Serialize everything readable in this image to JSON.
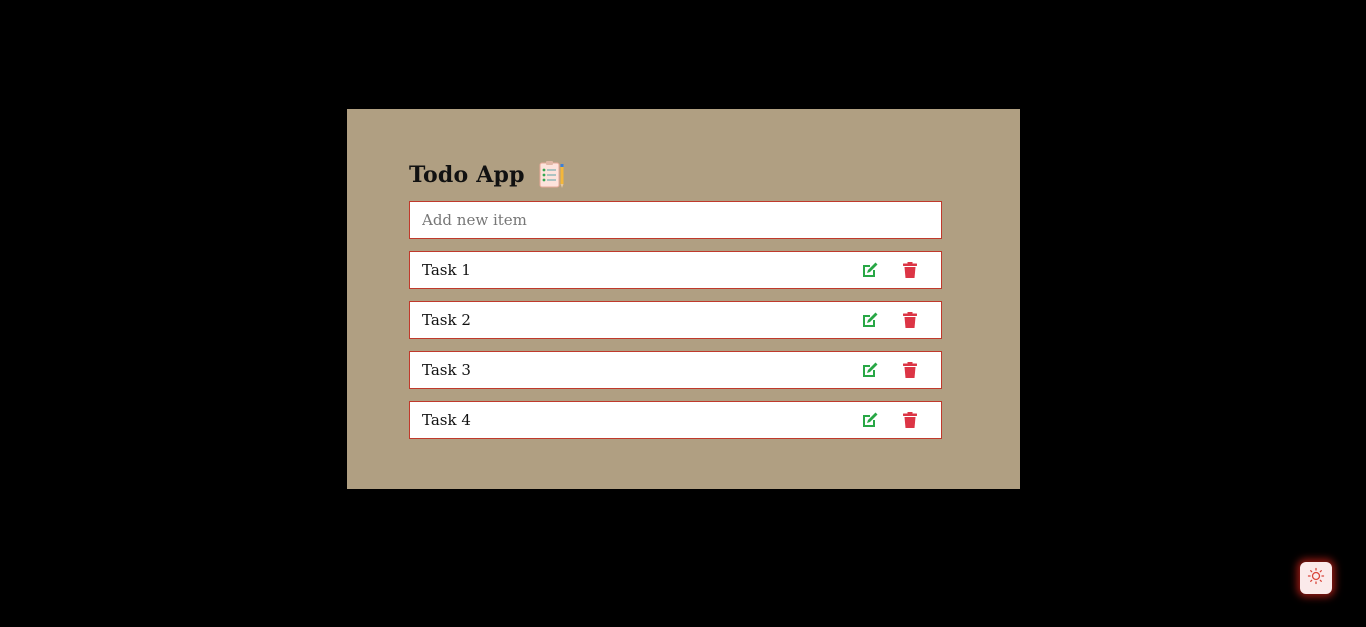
{
  "app": {
    "title": "Todo App"
  },
  "new_item": {
    "placeholder": "Add new item",
    "value": ""
  },
  "tasks": [
    {
      "label": "Task 1"
    },
    {
      "label": "Task 2"
    },
    {
      "label": "Task 3"
    },
    {
      "label": "Task 4"
    }
  ],
  "icons": {
    "title": "clipboard-checklist-icon",
    "edit": "edit-icon",
    "delete": "trash-icon",
    "theme": "sun-icon"
  },
  "colors": {
    "background": "#000000",
    "card": "#b09f82",
    "border": "#c0392b",
    "edit": "#28a745",
    "delete": "#dc3545",
    "theme_glow": "#e6281e"
  }
}
